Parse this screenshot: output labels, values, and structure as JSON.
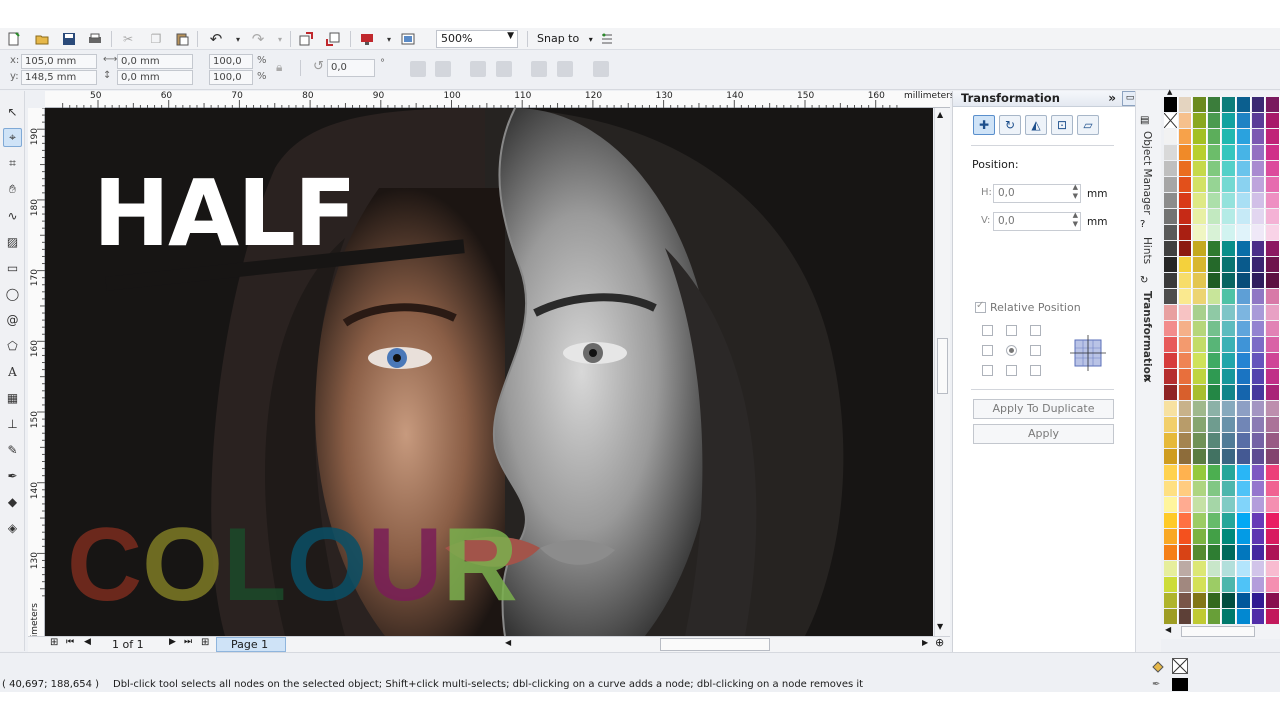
{
  "toolbar": {
    "zoom": "500%",
    "snap_to": "Snap to"
  },
  "propbar": {
    "x_label": "x:",
    "y_label": "y:",
    "x_value": "105,0 mm",
    "y_value": "148,5 mm",
    "w_value": "0,0 mm",
    "h_value": "0,0 mm",
    "scale_x": "100,0",
    "scale_y": "100,0",
    "percent": "%",
    "rotation": "0,0",
    "degree": "°"
  },
  "ruler": {
    "h_ticks": [
      "50",
      "60",
      "70",
      "80",
      "90",
      "100",
      "110",
      "120",
      "130",
      "140",
      "150",
      "160"
    ],
    "h_unit": "millimeters",
    "v_ticks": [
      "190",
      "180",
      "170",
      "160",
      "150",
      "140",
      "130"
    ],
    "v_unit": "millimeters"
  },
  "canvas": {
    "headline": "HALF",
    "colour_letters": [
      {
        "ch": "C",
        "color": "#7a2c1e"
      },
      {
        "ch": "O",
        "color": "#7e7a25"
      },
      {
        "ch": "L",
        "color": "#1b4a2a"
      },
      {
        "ch": "O",
        "color": "#0a4f66"
      },
      {
        "ch": "U",
        "color": "#7a1e57"
      },
      {
        "ch": "R",
        "color": "#7bb04e"
      }
    ]
  },
  "navigator": {
    "page_count": "1 of 1",
    "page_tab": "Page 1"
  },
  "docker": {
    "title": "Transformation",
    "position_label": "Position:",
    "h_label": "H:",
    "v_label": "V:",
    "h_value": "0,0",
    "v_value": "0,0",
    "unit": "mm",
    "relative_position": "Relative Position",
    "apply_to_duplicate": "Apply To Duplicate",
    "apply": "Apply"
  },
  "side_tabs": {
    "object_manager": "Object Manager",
    "hints": "Hints",
    "transformation": "Transformation"
  },
  "palette_colors": [
    [
      "#000000",
      "#e4d4c0",
      "#6b8a1f",
      "#3b7d3b",
      "#0e7d7a",
      "#0b5f8f",
      "#3c2a73",
      "#7a1a5e"
    ],
    [
      "#ffffff",
      "#f6c08c",
      "#8aa81f",
      "#4a9a4f",
      "#13a2a0",
      "#1f83c4",
      "#5a3c97",
      "#a8196a"
    ],
    [
      "#f2f2f2",
      "#f7a24a",
      "#a3c023",
      "#5cae5b",
      "#21b8b0",
      "#2aa2de",
      "#7c58b2",
      "#c02378"
    ],
    [
      "#d9d9d9",
      "#f08a28",
      "#b8cf2e",
      "#6cbd6a",
      "#36c6be",
      "#47b4e6",
      "#9470c2",
      "#d02f89"
    ],
    [
      "#bfbfbf",
      "#ea6d1f",
      "#c6d94a",
      "#80c97f",
      "#54d0c8",
      "#6ac4ec",
      "#a98ad0",
      "#dc4b9c"
    ],
    [
      "#a6a6a6",
      "#e2501b",
      "#d3e266",
      "#96d494",
      "#74d9d2",
      "#8ad2f0",
      "#bea4dc",
      "#e66caf"
    ],
    [
      "#8c8c8c",
      "#d93a18",
      "#dee985",
      "#acdfaa",
      "#94e2dc",
      "#a9dff4",
      "#d1bfe7",
      "#ee8fc2"
    ],
    [
      "#737373",
      "#c62a16",
      "#e8f0a4",
      "#c2e9c0",
      "#b4ebe6",
      "#c6eaf7",
      "#e2d6f0",
      "#f4b2d5"
    ],
    [
      "#595959",
      "#a91f12",
      "#f0f6c3",
      "#d8f2d6",
      "#d1f3f0",
      "#e0f3fa",
      "#efe8f7",
      "#f9d3e7"
    ],
    [
      "#404040",
      "#8c1a10",
      "#c4a91f",
      "#2f7a2f",
      "#0b8e8a",
      "#0a6ea8",
      "#4b2f88",
      "#8c1a62"
    ],
    [
      "#262626",
      "#f4d13c",
      "#d8b72e",
      "#25692a",
      "#0a7471",
      "#095a8c",
      "#3a2470",
      "#6e144d"
    ],
    [
      "#3a3a3a",
      "#f7dd6a",
      "#e3c650",
      "#1f5c24",
      "#086562",
      "#084d79",
      "#2f1d5e",
      "#5c1041"
    ],
    [
      "#4d4d4d",
      "#fae98f",
      "#ecd472",
      "#c8e59a",
      "#4fc2a6",
      "#5e9fd6",
      "#8f77c4",
      "#d87aa8"
    ],
    [
      "#e8a0a0",
      "#f7c3c3",
      "#a8d08d",
      "#8fc9a5",
      "#7fc5c7",
      "#7cb5e0",
      "#a99ad8",
      "#e8a1c4"
    ],
    [
      "#f28c8c",
      "#f5b089",
      "#b6d67a",
      "#74c08d",
      "#5dbbbe",
      "#5fa5dc",
      "#9383d0",
      "#e182b5"
    ],
    [
      "#e75a5a",
      "#f39a6e",
      "#c3dc68",
      "#58b577",
      "#3bb1b5",
      "#3f94d7",
      "#7c6bc6",
      "#d962a6"
    ],
    [
      "#d63c3c",
      "#ef8454",
      "#cfe25a",
      "#40aa63",
      "#22a6aa",
      "#2584d2",
      "#6654bc",
      "#cf4597"
    ],
    [
      "#b52e2e",
      "#e86f3c",
      "#bfd43f",
      "#2f9a52",
      "#18979b",
      "#1a74c2",
      "#5443ae",
      "#c02f88"
    ],
    [
      "#8f2424",
      "#d85f2c",
      "#a8be2e",
      "#248745",
      "#12858a",
      "#1565ad",
      "#46379d",
      "#a92478"
    ],
    [
      "#f7e1a1",
      "#c8b28a",
      "#9fb88c",
      "#8bb1a7",
      "#86a9bd",
      "#8d9fc4",
      "#a395c2",
      "#bd8fae"
    ],
    [
      "#f2cf6b",
      "#b89c6a",
      "#86a570",
      "#6f9c8f",
      "#6992aa",
      "#7186b6",
      "#8b7bb4",
      "#ab7399"
    ],
    [
      "#e6b93a",
      "#a48450",
      "#6f9157",
      "#578778",
      "#507b97",
      "#586ea6",
      "#7462a5",
      "#985a84"
    ],
    [
      "#cf9c1f",
      "#8d6c3a",
      "#5a7c42",
      "#427262",
      "#3b6683",
      "#445993",
      "#5e4c93",
      "#83446f"
    ],
    [
      "#ffd24f",
      "#ffb24f",
      "#95c93d",
      "#4caf50",
      "#26a69a",
      "#29b6f6",
      "#7e57c2",
      "#ec407a"
    ],
    [
      "#ffe082",
      "#ffcc80",
      "#aed581",
      "#81c784",
      "#4db6ac",
      "#4fc3f7",
      "#9575cd",
      "#f06292"
    ],
    [
      "#fff59d",
      "#ffab91",
      "#c5e1a5",
      "#a5d6a7",
      "#80cbc4",
      "#81d4fa",
      "#b39ddb",
      "#f48fb1"
    ],
    [
      "#ffca28",
      "#ff7043",
      "#9ccc65",
      "#66bb6a",
      "#26a69a",
      "#03a9f4",
      "#673ab7",
      "#e91e63"
    ],
    [
      "#f9a825",
      "#f4511e",
      "#7cb342",
      "#43a047",
      "#00897b",
      "#039be5",
      "#5e35b1",
      "#d81b60"
    ],
    [
      "#f57f17",
      "#d84315",
      "#558b2f",
      "#2e7d32",
      "#00695c",
      "#0277bd",
      "#4527a0",
      "#ad1457"
    ],
    [
      "#e6ee9c",
      "#bcaaa4",
      "#dce775",
      "#c8e6c9",
      "#b2dfdb",
      "#b3e5fc",
      "#d1c4e9",
      "#f8bbd0"
    ],
    [
      "#cddc39",
      "#a1887f",
      "#d4e157",
      "#9ccc65",
      "#4db6ac",
      "#4fc3f7",
      "#b39ddb",
      "#f48fb1"
    ],
    [
      "#afb42b",
      "#795548",
      "#827717",
      "#33691e",
      "#004d40",
      "#01579b",
      "#311b92",
      "#880e4f"
    ],
    [
      "#9e9d24",
      "#5d4037",
      "#c0ca33",
      "#689f38",
      "#00796b",
      "#0288d1",
      "#512da8",
      "#c2185b"
    ]
  ],
  "status": {
    "coords": "( 40,697; 188,654 )",
    "message": "Dbl-click tool selects all nodes on the selected object; Shift+click multi-selects; dbl-clicking on a curve adds a node; dbl-clicking on a node removes it"
  }
}
